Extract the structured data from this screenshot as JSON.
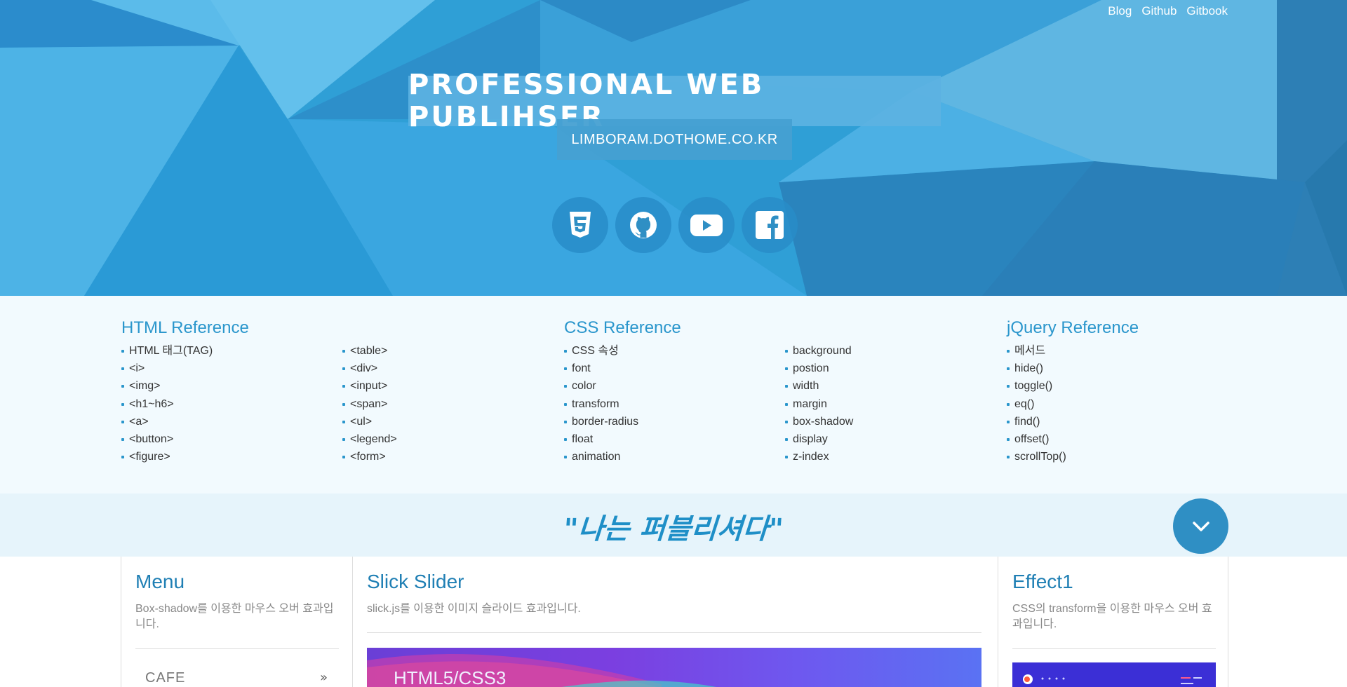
{
  "nav": {
    "links": [
      "Blog",
      "Github",
      "Gitbook"
    ]
  },
  "hero": {
    "title": "PROFESSIONAL WEB PUBLIHSER",
    "subtitle": "LIMBORAM.DOTHOME.CO.KR",
    "socials": [
      "css3-icon",
      "github-icon",
      "youtube-icon",
      "facebook-icon"
    ]
  },
  "references": {
    "html": {
      "title": "HTML Reference",
      "col1": [
        "HTML 태그(TAG)",
        "<i>",
        "<img>",
        "<h1~h6>",
        "<a>",
        "<button>",
        "<figure>"
      ],
      "col2": [
        "<table>",
        "<div>",
        "<input>",
        "<span>",
        "<ul>",
        "<legend>",
        "<form>"
      ]
    },
    "css": {
      "title": "CSS Reference",
      "col1": [
        "CSS 속성",
        "font",
        "color",
        "transform",
        "border-radius",
        "float",
        "animation"
      ],
      "col2": [
        "background",
        "postion",
        "width",
        "margin",
        "box-shadow",
        "display",
        "z-index"
      ]
    },
    "jquery": {
      "title": "jQuery Reference",
      "col1": [
        "메서드",
        "hide()",
        "toggle()",
        "eq()",
        "find()",
        "offset()",
        "scrollTop()"
      ]
    }
  },
  "slogan": {
    "text": "\"나는 퍼블리셔다\""
  },
  "cards": {
    "menu": {
      "title": "Menu",
      "desc": "Box-shadow를 이용한 마우스 오버 효과입니다.",
      "item": "CAFE",
      "arrow": "»"
    },
    "slick": {
      "title": "Slick Slider",
      "desc": "slick.js를 이용한 이미지 슬라이드 효과입니다.",
      "slide_title": "HTML5/CSS3"
    },
    "effect": {
      "title": "Effect1",
      "desc": "CSS의 transform을 이용한 마우스 오버 효과입니다."
    }
  },
  "colors": {
    "accent": "#2a96cc",
    "hero": "#2f9fd6",
    "slogan_bg": "#e6f4fb",
    "ref_bg": "#f2fafe"
  }
}
